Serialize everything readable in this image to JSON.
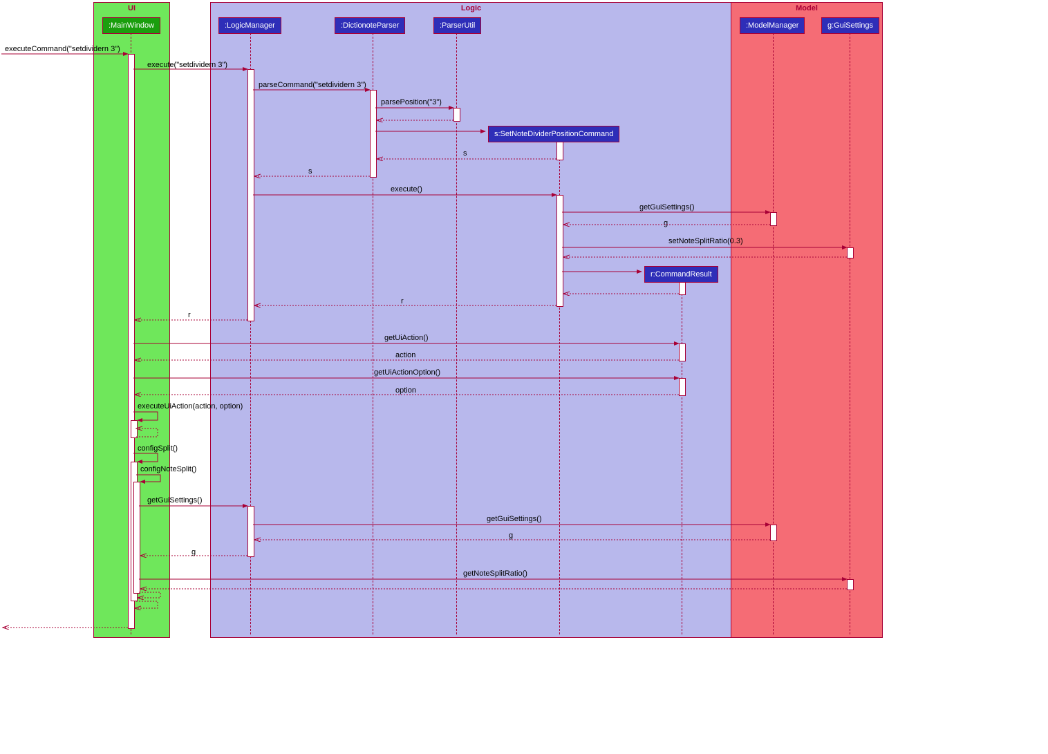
{
  "boxes": {
    "ui": "UI",
    "logic": "Logic",
    "model": "Model"
  },
  "participants": {
    "mainwindow": ":MainWindow",
    "logicmgr": ":LogicManager",
    "parser": ":DictionoteParser",
    "parserutil": ":ParserUtil",
    "sndpc": "s:SetNoteDividerPositionCommand",
    "commandresult": "r:CommandResult",
    "modelmgr": ":ModelManager",
    "guisettings": "g:GuiSettings"
  },
  "messages": {
    "m1": "executeCommand(\"setdividern 3\")",
    "m2": "execute(\"setdividern 3\")",
    "m3": "parseCommand(\"setdividern 3\")",
    "m4": "parsePosition(\"3\")",
    "m5ret": " ",
    "m6": "s",
    "m7": "s",
    "m8": "execute()",
    "m9": "getGuiSettings()",
    "m10": "g",
    "m11": "setNoteSplitRatio(0.3)",
    "m12ret": "r",
    "m13": "r",
    "m14": "getUiAction()",
    "m15": "action",
    "m16": "getUiActionOption()",
    "m17": "option",
    "m18": "executeUiAction(action, option)",
    "m19": "configSplit()",
    "m20": "configNoteSplit()",
    "m21": "getGuiSettings()",
    "m22": "getGuiSettings()",
    "m23": "g",
    "m24": "g",
    "m25": "getNoteSplitRatio()"
  }
}
